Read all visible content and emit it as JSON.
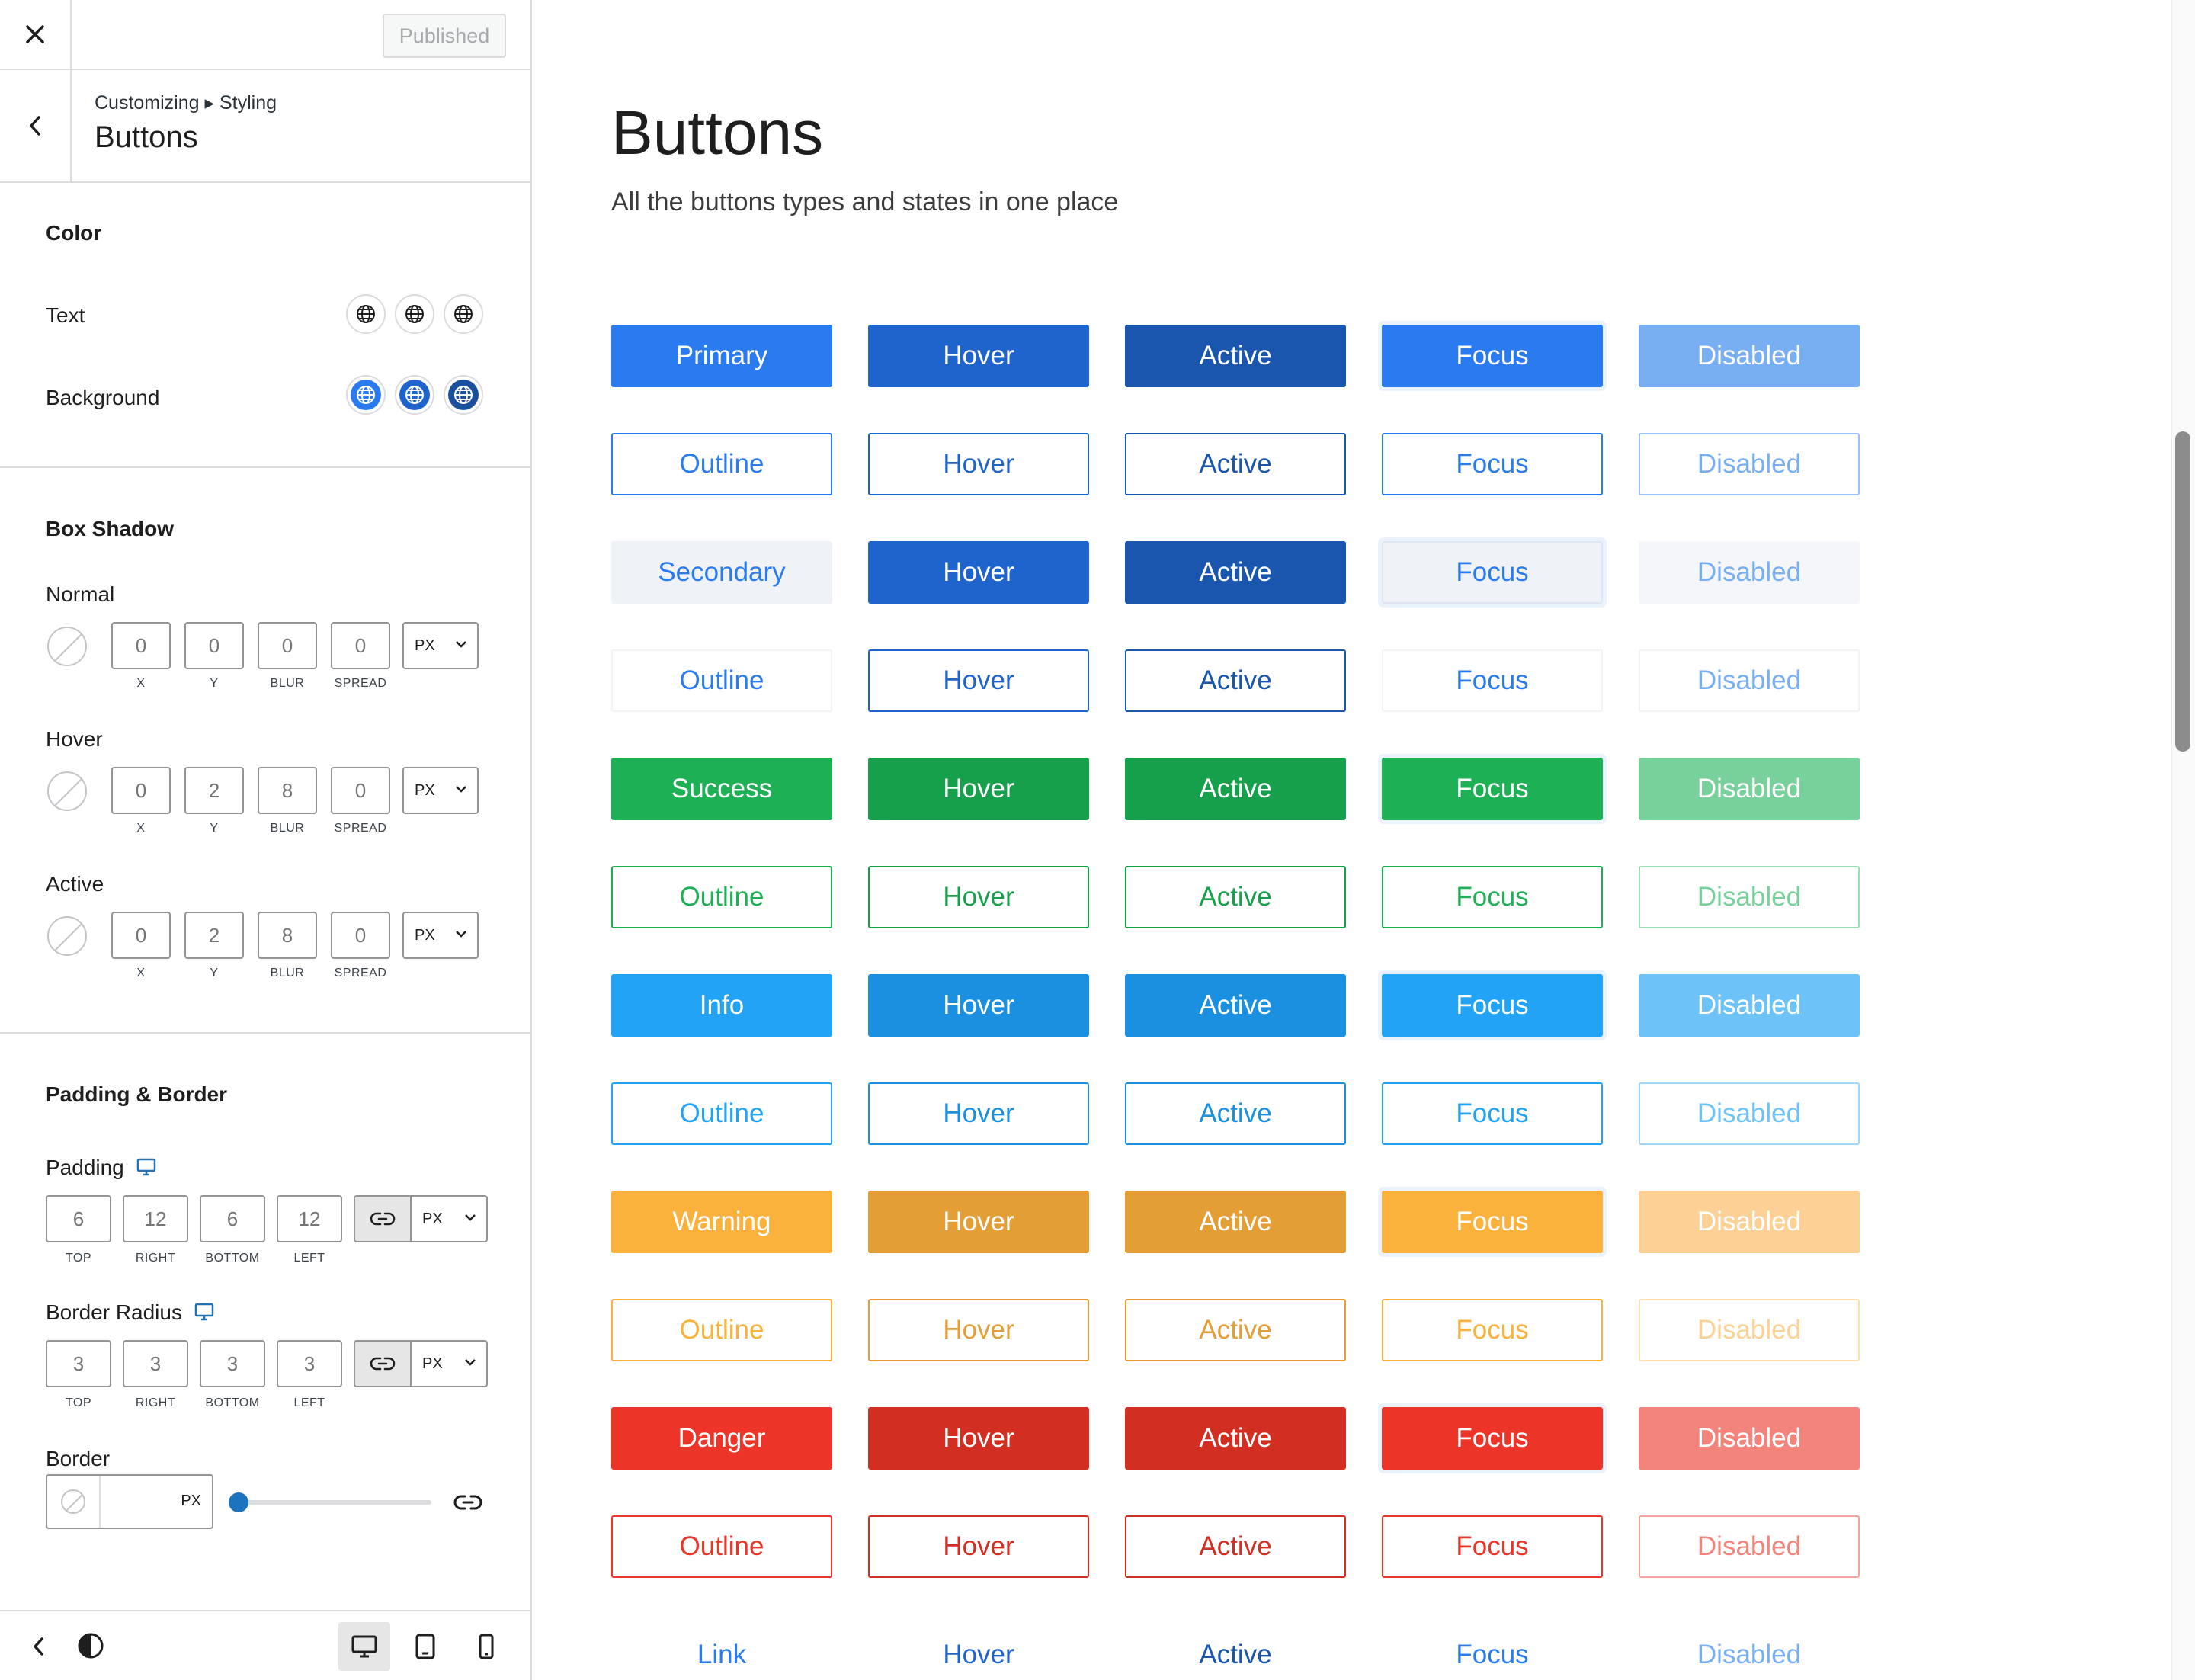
{
  "topbar": {
    "close_label": "Close",
    "publish_label": "Published"
  },
  "header": {
    "breadcrumb": "Customizing ▸ Styling",
    "title": "Buttons"
  },
  "color": {
    "heading": "Color",
    "text_label": "Text",
    "background_label": "Background",
    "background_swatches": [
      "#2b7bf0",
      "#1f63cc",
      "#1a4f9e"
    ]
  },
  "box_shadow": {
    "heading": "Box Shadow",
    "captions": [
      "X",
      "Y",
      "BLUR",
      "SPREAD"
    ],
    "unit": "PX",
    "rows": [
      {
        "label": "Normal",
        "values": [
          "0",
          "0",
          "0",
          "0"
        ]
      },
      {
        "label": "Hover",
        "values": [
          "0",
          "2",
          "8",
          "0"
        ]
      },
      {
        "label": "Active",
        "values": [
          "0",
          "2",
          "8",
          "0"
        ]
      }
    ]
  },
  "padding_border": {
    "heading": "Padding & Border",
    "captions": [
      "TOP",
      "RIGHT",
      "BOTTOM",
      "LEFT"
    ],
    "unit": "PX",
    "padding": {
      "label": "Padding",
      "values": [
        "6",
        "12",
        "6",
        "12"
      ]
    },
    "radius": {
      "label": "Border Radius",
      "values": [
        "3",
        "3",
        "3",
        "3"
      ]
    },
    "border": {
      "label": "Border",
      "unit": "PX",
      "value": ""
    }
  },
  "preview": {
    "title": "Buttons",
    "subtitle": "All the buttons types and states in one place",
    "rows": [
      {
        "labels": [
          "Primary",
          "Hover",
          "Active",
          "Focus",
          "Disabled"
        ],
        "bg": [
          "#2b7bf0",
          "#1f63cc",
          "#1a56ad",
          "#2b7bf0",
          "#78aef2"
        ],
        "fg": [
          "#ffffff",
          "#ffffff",
          "#ffffff",
          "#ffffff",
          "#ffffff"
        ],
        "border": [
          "#2b7bf0",
          "#1f63cc",
          "#1a56ad",
          "#2b7bf0",
          "#78aef2"
        ]
      },
      {
        "labels": [
          "Outline",
          "Hover",
          "Active",
          "Focus",
          "Disabled"
        ],
        "bg": [
          "#ffffff",
          "#ffffff",
          "#ffffff",
          "#ffffff",
          "#ffffff"
        ],
        "fg": [
          "#2b7bf0",
          "#1f63cc",
          "#1a56ad",
          "#2b7bf0",
          "#78aef2"
        ],
        "border": [
          "#2b7bf0",
          "#1f63cc",
          "#1a56ad",
          "#2b7bf0",
          "#9dc2f5"
        ]
      },
      {
        "labels": [
          "Secondary",
          "Hover",
          "Active",
          "Focus",
          "Disabled"
        ],
        "bg": [
          "#eff2f6",
          "#1f63cc",
          "#1a56ad",
          "#eff2f6",
          "#f4f6f9"
        ],
        "fg": [
          "#2b7bf0",
          "#ffffff",
          "#ffffff",
          "#2b7bf0",
          "#78aef2"
        ],
        "border": [
          "#eff2f6",
          "#1f63cc",
          "#1a56ad",
          "#dde6f2",
          "#f4f6f9"
        ]
      },
      {
        "labels": [
          "Outline",
          "Hover",
          "Active",
          "Focus",
          "Disabled"
        ],
        "bg": [
          "#ffffff",
          "#ffffff",
          "#ffffff",
          "#ffffff",
          "#ffffff"
        ],
        "fg": [
          "#2b7bf0",
          "#1f63cc",
          "#1a56ad",
          "#2b7bf0",
          "#78aef2"
        ],
        "border": [
          "#f1f3f6",
          "#1f63cc",
          "#1a56ad",
          "#f1f3f6",
          "#f1f3f6"
        ]
      },
      {
        "labels": [
          "Success",
          "Hover",
          "Active",
          "Focus",
          "Disabled"
        ],
        "bg": [
          "#1db055",
          "#17a04b",
          "#17a04b",
          "#1db055",
          "#78d09b"
        ],
        "fg": [
          "#ffffff",
          "#ffffff",
          "#ffffff",
          "#ffffff",
          "#ffffff"
        ],
        "border": [
          "#1db055",
          "#17a04b",
          "#17a04b",
          "#1db055",
          "#78d09b"
        ]
      },
      {
        "labels": [
          "Outline",
          "Hover",
          "Active",
          "Focus",
          "Disabled"
        ],
        "bg": [
          "#ffffff",
          "#ffffff",
          "#ffffff",
          "#ffffff",
          "#ffffff"
        ],
        "fg": [
          "#1db055",
          "#17a04b",
          "#17a04b",
          "#1db055",
          "#78d09b"
        ],
        "border": [
          "#1db055",
          "#17a04b",
          "#17a04b",
          "#1db055",
          "#9edcb6"
        ]
      },
      {
        "labels": [
          "Info",
          "Hover",
          "Active",
          "Focus",
          "Disabled"
        ],
        "bg": [
          "#22a3f5",
          "#1b8fe0",
          "#1b8fe0",
          "#22a3f5",
          "#6dc2f8"
        ],
        "fg": [
          "#ffffff",
          "#ffffff",
          "#ffffff",
          "#ffffff",
          "#ffffff"
        ],
        "border": [
          "#22a3f5",
          "#1b8fe0",
          "#1b8fe0",
          "#22a3f5",
          "#6dc2f8"
        ]
      },
      {
        "labels": [
          "Outline",
          "Hover",
          "Active",
          "Focus",
          "Disabled"
        ],
        "bg": [
          "#ffffff",
          "#ffffff",
          "#ffffff",
          "#ffffff",
          "#ffffff"
        ],
        "fg": [
          "#22a3f5",
          "#1b8fe0",
          "#1b8fe0",
          "#22a3f5",
          "#6dc2f8"
        ],
        "border": [
          "#22a3f5",
          "#1b8fe0",
          "#1b8fe0",
          "#22a3f5",
          "#9fd6fa"
        ]
      },
      {
        "labels": [
          "Warning",
          "Hover",
          "Active",
          "Focus",
          "Disabled"
        ],
        "bg": [
          "#fbb23d",
          "#e49e36",
          "#e49e36",
          "#fbb23d",
          "#fdd195"
        ],
        "fg": [
          "#ffffff",
          "#ffffff",
          "#ffffff",
          "#ffffff",
          "#ffffff"
        ],
        "border": [
          "#fbb23d",
          "#e49e36",
          "#e49e36",
          "#fbb23d",
          "#fdd195"
        ]
      },
      {
        "labels": [
          "Outline",
          "Hover",
          "Active",
          "Focus",
          "Disabled"
        ],
        "bg": [
          "#ffffff",
          "#ffffff",
          "#ffffff",
          "#ffffff",
          "#ffffff"
        ],
        "fg": [
          "#fbb23d",
          "#e49e36",
          "#e49e36",
          "#fbb23d",
          "#fdd195"
        ],
        "border": [
          "#fbb23d",
          "#e49e36",
          "#e49e36",
          "#fbb23d",
          "#fde0b4"
        ]
      },
      {
        "labels": [
          "Danger",
          "Hover",
          "Active",
          "Focus",
          "Disabled"
        ],
        "bg": [
          "#ec3528",
          "#d22e22",
          "#d22e22",
          "#ec3528",
          "#f2847c"
        ],
        "fg": [
          "#ffffff",
          "#ffffff",
          "#ffffff",
          "#ffffff",
          "#ffffff"
        ],
        "border": [
          "#ec3528",
          "#d22e22",
          "#d22e22",
          "#ec3528",
          "#f2847c"
        ]
      },
      {
        "labels": [
          "Outline",
          "Hover",
          "Active",
          "Focus",
          "Disabled"
        ],
        "bg": [
          "#ffffff",
          "#ffffff",
          "#ffffff",
          "#ffffff",
          "#ffffff"
        ],
        "fg": [
          "#ec3528",
          "#d22e22",
          "#d22e22",
          "#ec3528",
          "#f2847c"
        ],
        "border": [
          "#ec3528",
          "#d22e22",
          "#d22e22",
          "#ec3528",
          "#f4a39d"
        ]
      },
      {
        "labels": [
          "Link",
          "Hover",
          "Active",
          "Focus",
          "Disabled"
        ],
        "bg": [
          "#ffffff",
          "#ffffff",
          "#ffffff",
          "#ffffff",
          "#ffffff"
        ],
        "fg": [
          "#2b7bf0",
          "#1f63cc",
          "#1a56ad",
          "#2b7bf0",
          "#78aef2"
        ],
        "border": [
          "#ffffff",
          "#ffffff",
          "#ffffff",
          "#ffffff",
          "#ffffff"
        ]
      }
    ]
  }
}
